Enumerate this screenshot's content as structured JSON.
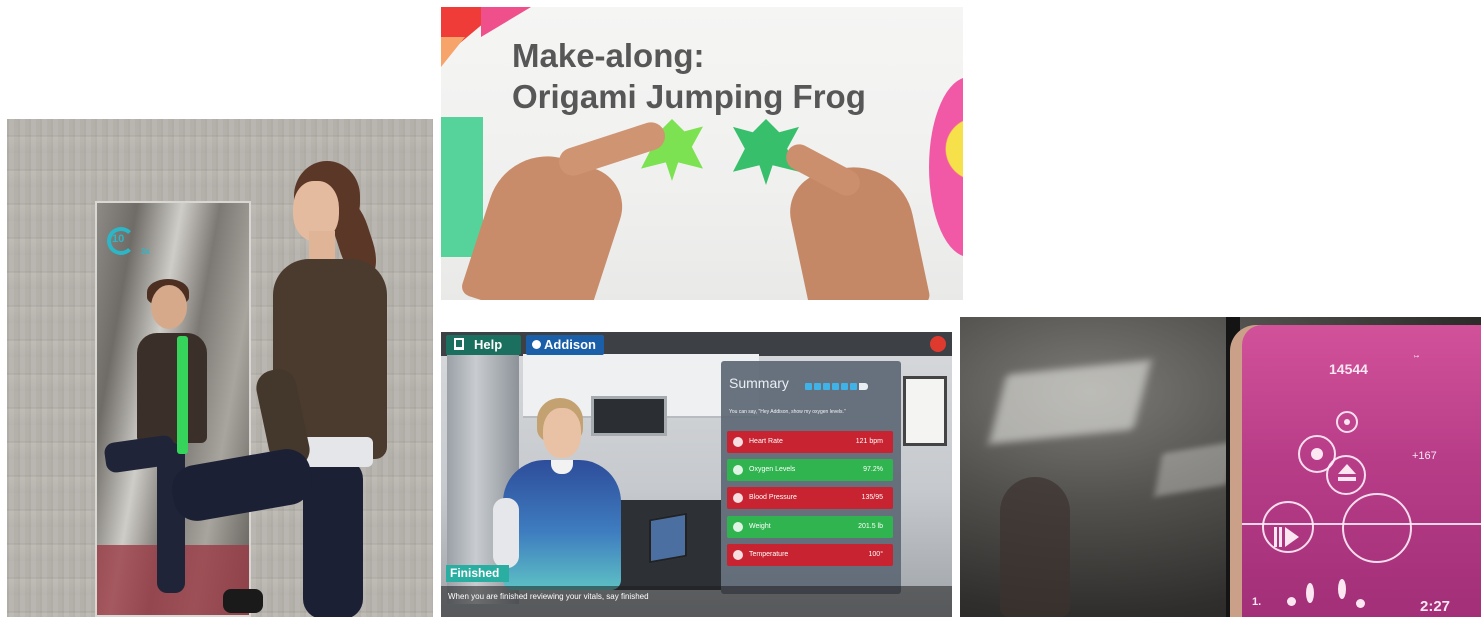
{
  "mirror": {
    "timer_value": "10",
    "timer_sub": "3x"
  },
  "origami": {
    "title_line1": "Make-along:",
    "title_line2": "Origami Jumping Frog"
  },
  "nurse": {
    "help_label": "Help",
    "assistant_label": "Addison",
    "summary_title": "Summary",
    "summary_prompt": "You can say, \"Hey Addison, show my oxygen levels.\"",
    "vitals": [
      {
        "label": "Heart Rate",
        "value": "121 bpm",
        "status": "red"
      },
      {
        "label": "Oxygen Levels",
        "value": "97.2%",
        "status": "green"
      },
      {
        "label": "Blood Pressure",
        "value": "135/95",
        "status": "red"
      },
      {
        "label": "Weight",
        "value": "201.5 lb",
        "status": "green"
      },
      {
        "label": "Temperature",
        "value": "100°",
        "status": "red"
      }
    ],
    "finished_label": "Finished",
    "instruction": "When you are finished reviewing your vitals, say finished",
    "colors": {
      "alert": "#c72330",
      "ok": "#30b44f",
      "help": "#1a6f5e",
      "assistant": "#1b5fa8",
      "finished": "#2aaea2"
    }
  },
  "rhythm_game": {
    "score": "14544",
    "bonus": "+167",
    "level": "1.",
    "timer": "2:27",
    "accent_color": "#c2418c"
  }
}
